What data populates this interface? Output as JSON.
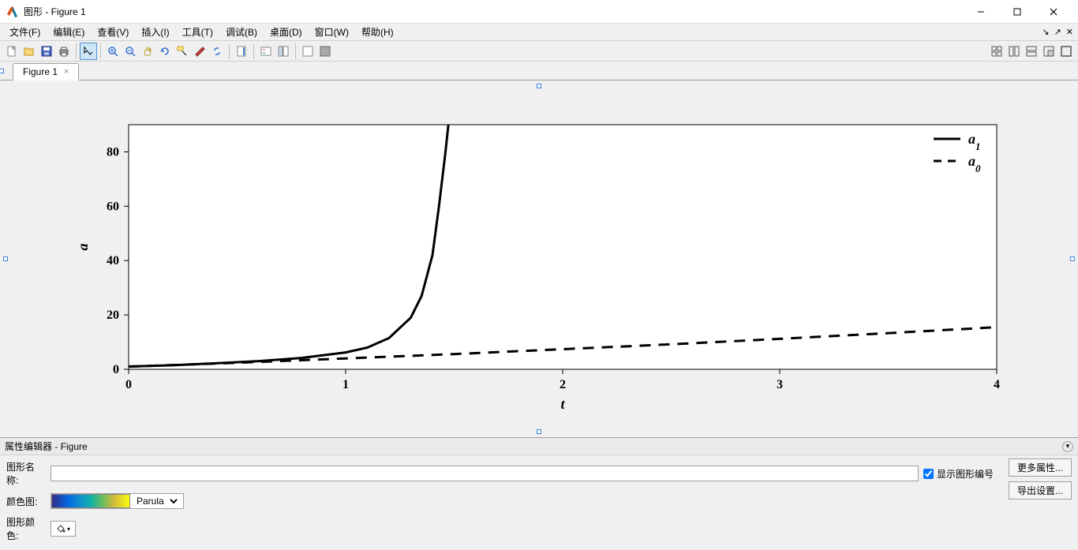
{
  "window": {
    "title": "图形 - Figure 1"
  },
  "menubar": {
    "file": "文件(F)",
    "edit": "编辑(E)",
    "view": "查看(V)",
    "insert": "插入(I)",
    "tools": "工具(T)",
    "debug": "调试(B)",
    "desktop": "桌面(D)",
    "window": "窗口(W)",
    "help": "帮助(H)"
  },
  "tabs": {
    "figure1": "Figure 1"
  },
  "chart_data": {
    "type": "line",
    "xlabel": "t",
    "ylabel": "a",
    "xlim": [
      0,
      4
    ],
    "ylim": [
      0,
      90
    ],
    "xticks": [
      0,
      1,
      2,
      3,
      4
    ],
    "yticks": [
      0,
      20,
      40,
      60,
      80
    ],
    "legend_position": "top-right",
    "series": [
      {
        "name": "a1",
        "label_html": "a₁",
        "line": "solid",
        "x": [
          0,
          0.2,
          0.4,
          0.6,
          0.8,
          1.0,
          1.1,
          1.2,
          1.3,
          1.35,
          1.4,
          1.43,
          1.46,
          1.48,
          1.5
        ],
        "y": [
          1,
          1.5,
          2.2,
          3.0,
          4.2,
          6.2,
          8.0,
          11.5,
          19.0,
          27.0,
          42.0,
          60.0,
          80.0,
          95.0,
          120.0
        ]
      },
      {
        "name": "a0",
        "label_html": "a₀",
        "line": "dashed",
        "x": [
          0,
          0.5,
          1.0,
          1.5,
          2.0,
          2.5,
          3.0,
          3.5,
          4.0
        ],
        "y": [
          1,
          2.4,
          4.0,
          5.6,
          7.4,
          9.2,
          11.2,
          13.3,
          15.5
        ]
      }
    ]
  },
  "prop_editor": {
    "title": "属性编辑器 - Figure",
    "name_label": "图形名称:",
    "name_value": "",
    "show_number_label": "显示图形编号",
    "show_number_checked": true,
    "more_props_btn": "更多属性...",
    "colormap_label": "颜色图:",
    "colormap_value": "Parula",
    "export_btn": "导出设置...",
    "figure_color_label": "图形颜色:"
  }
}
